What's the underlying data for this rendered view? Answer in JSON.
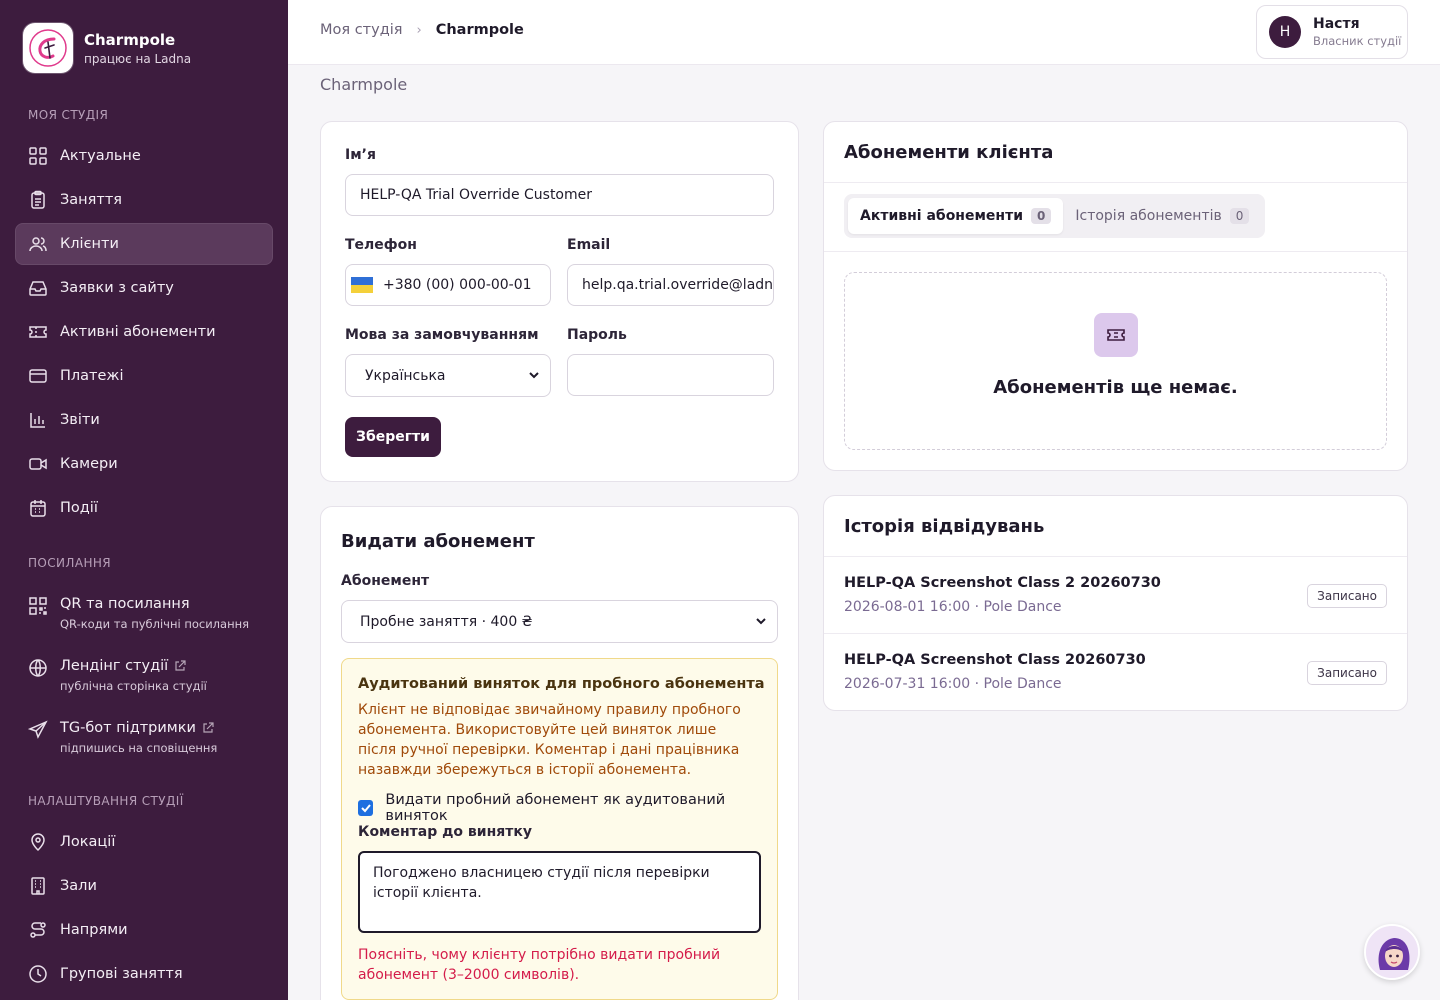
{
  "brand": {
    "name": "Charmpole",
    "sub": "працює на Ladna"
  },
  "sidebar": {
    "section_studio": "МОЯ СТУДІЯ",
    "items": [
      {
        "label": "Актуальне",
        "icon": "dashboard-icon"
      },
      {
        "label": "Заняття",
        "icon": "clipboard-icon"
      },
      {
        "label": "Клієнти",
        "icon": "users-icon",
        "active": true
      },
      {
        "label": "Заявки з сайту",
        "icon": "inbox-icon"
      },
      {
        "label": "Активні абонементи",
        "icon": "ticket-icon"
      },
      {
        "label": "Платежі",
        "icon": "card-icon"
      },
      {
        "label": "Звіти",
        "icon": "chart-icon"
      },
      {
        "label": "Камери",
        "icon": "video-icon"
      },
      {
        "label": "Події",
        "icon": "calendar-icon"
      }
    ],
    "section_links": "ПОСИЛАННЯ",
    "links": [
      {
        "label": "QR та посилання",
        "sub": "QR-коди та публічні посилання"
      },
      {
        "label": "Лендінг студії",
        "sub": "публічна сторінка студії"
      },
      {
        "label": "TG-бот підтримки",
        "sub": "підпишись на сповіщення"
      }
    ],
    "section_settings": "НАЛАШТУВАННЯ СТУДІЇ",
    "settings": [
      {
        "label": "Локації"
      },
      {
        "label": "Зали"
      },
      {
        "label": "Напрями"
      },
      {
        "label": "Групові заняття"
      }
    ]
  },
  "breadcrumb": {
    "home": "Моя студія",
    "current": "Charmpole"
  },
  "user": {
    "initial": "Н",
    "name": "Настя",
    "role": "Власник студії"
  },
  "page": {
    "subtitle": "Charmpole"
  },
  "profile_form": {
    "name_label": "Ім’я",
    "name_value": "HELP-QA Trial Override Customer",
    "phone_label": "Телефон",
    "phone_value": "+380 (00) 000-00-01",
    "email_label": "Email",
    "email_value": "help.qa.trial.override@ladna",
    "language_label": "Мова за замовчуванням",
    "language_value": "Українська",
    "password_label": "Пароль",
    "password_value": "",
    "save_label": "Зберегти"
  },
  "issue_pass": {
    "title": "Видати абонемент",
    "pass_label": "Абонемент",
    "pass_value": "Пробне заняття · 400 ₴",
    "warning": {
      "title": "Аудитований виняток для пробного абонемента",
      "text": "Клієнт не відповідає звичайному правилу пробного абонемента. Використовуйте цей виняток лише після ручної перевірки. Коментар і дані працівника назавжди збережуться в історії абонемента.",
      "checkbox_label": "Видати пробний абонемент як аудитований виняток",
      "checkbox_checked": true,
      "comment_label": "Коментар до винятку",
      "comment_value": "Погоджено власницею студії після перевірки історії клієнта.",
      "error": "Поясніть, чому клієнту потрібно видати пробний абонемент (3–2000 символів)."
    }
  },
  "passes": {
    "title": "Абонементи клієнта",
    "tab_active": "Активні абонементи",
    "tab_active_count": "0",
    "tab_history": "Історія абонементів",
    "tab_history_count": "0",
    "empty_text": "Абонементів ще немає."
  },
  "visits": {
    "title": "Історія відвідувань",
    "items": [
      {
        "title": "HELP-QA Screenshot Class 2 20260730",
        "meta": "2026-08-01 16:00 · Pole Dance",
        "status": "Записано"
      },
      {
        "title": "HELP-QA Screenshot Class 20260730",
        "meta": "2026-07-31 16:00 · Pole Dance",
        "status": "Записано"
      }
    ]
  },
  "colors": {
    "sidebar_bg": "#3d1c3e",
    "accent": "#3d1c3e",
    "warning_bg": "#fefbea",
    "error": "#d41c4a"
  }
}
